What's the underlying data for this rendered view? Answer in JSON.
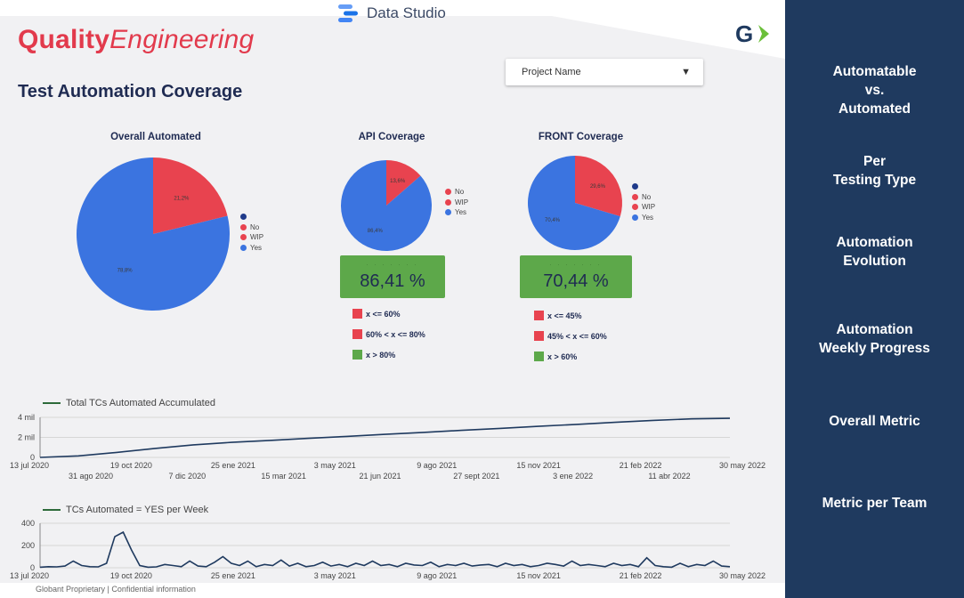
{
  "app": {
    "title": "Data Studio"
  },
  "brand": {
    "bold": "Quality",
    "italic": "Engineering"
  },
  "logo": {
    "letter": "G",
    "accent": "#6bbf3a"
  },
  "page_title": "Test Automation Coverage",
  "project_select": {
    "value": "Project Name"
  },
  "charts": {
    "overall": {
      "title": "Overall Automated",
      "yes_pct_label": "78,8%",
      "no_pct_label": "21,2%"
    },
    "api": {
      "title": "API Coverage",
      "yes_pct_label": "86,4%",
      "no_pct_label": "13,6%",
      "metric": "86,41 %"
    },
    "front": {
      "title": "FRONT Coverage",
      "yes_pct_label": "70,4%",
      "no_pct_label": "29,6%",
      "metric": "70,44 %"
    }
  },
  "legend": {
    "no": "No",
    "wip": "WIP",
    "yes": "Yes"
  },
  "colors": {
    "no": "#e8434f",
    "wip": "#e8434f",
    "yes": "#3b74e0",
    "good": "#5da84a",
    "sidebar": "#1f3a5f",
    "brand": "#e23a4c",
    "line": "#2d6a3a"
  },
  "thresholds_api": [
    "x <= 60%",
    "60% < x <= 80%",
    "x > 80%"
  ],
  "thresholds_front": [
    "x <= 45%",
    "45% < x <= 60%",
    "x > 60%"
  ],
  "chart_data": [
    {
      "type": "pie",
      "title": "Overall Automated",
      "categories": [
        "No",
        "WIP",
        "Yes"
      ],
      "values": [
        21.2,
        0,
        78.8
      ]
    },
    {
      "type": "pie",
      "title": "API Coverage",
      "categories": [
        "No",
        "WIP",
        "Yes"
      ],
      "values": [
        13.6,
        0,
        86.4
      ]
    },
    {
      "type": "pie",
      "title": "FRONT Coverage",
      "categories": [
        "No",
        "WIP",
        "Yes"
      ],
      "values": [
        29.6,
        0,
        70.4
      ]
    },
    {
      "type": "line",
      "legend": "Total TCs Automated Accumulated",
      "y_ticks": [
        "4 mil",
        "2 mil",
        "0"
      ],
      "ylim": [
        0,
        4000
      ],
      "x_ticks_top": [
        "13 jul 2020",
        "19 oct 2020",
        "25 ene 2021",
        "3 may 2021",
        "9 ago 2021",
        "15 nov 2021",
        "21 feb 2022",
        "30 may 2022"
      ],
      "x_ticks_bottom": [
        "31 ago 2020",
        "7 dic 2020",
        "15 mar 2021",
        "21 jun 2021",
        "27 sept 2021",
        "3 ene 2022",
        "11 abr 2022"
      ],
      "series": [
        {
          "name": "Total TCs Automated Accumulated",
          "values": [
            0,
            150,
            500,
            900,
            1250,
            1500,
            1700,
            1900,
            2100,
            2300,
            2500,
            2700,
            2900,
            3100,
            3300,
            3500,
            3700,
            3850,
            3900
          ]
        }
      ]
    },
    {
      "type": "line",
      "legend": "TCs Automated = YES per Week",
      "y_ticks": [
        "400",
        "200",
        "0"
      ],
      "ylim": [
        0,
        400
      ],
      "x_ticks_top": [
        "13 jul 2020",
        "19 oct 2020",
        "25 ene 2021",
        "3 may 2021",
        "9 ago 2021",
        "15 nov 2021",
        "21 feb 2022",
        "30 may 2022"
      ],
      "series": [
        {
          "name": "TCs Automated = YES per Week",
          "values": [
            5,
            10,
            8,
            15,
            60,
            20,
            10,
            8,
            40,
            280,
            320,
            160,
            20,
            5,
            8,
            30,
            20,
            10,
            60,
            15,
            10,
            50,
            100,
            40,
            20,
            60,
            10,
            30,
            20,
            70,
            15,
            40,
            10,
            20,
            50,
            15,
            30,
            10,
            40,
            20,
            60,
            20,
            30,
            10,
            40,
            25,
            20,
            50,
            10,
            30,
            20,
            40,
            15,
            25,
            30,
            10,
            40,
            20,
            30,
            10,
            20,
            40,
            30,
            15,
            60,
            20,
            30,
            20,
            10,
            40,
            20,
            30,
            10,
            90,
            20,
            10,
            5,
            40,
            10,
            30,
            20,
            60,
            15,
            10
          ]
        }
      ]
    }
  ],
  "footer": "Globant Proprietary | Confidential information",
  "sidebar": [
    "Automatable vs. Automated",
    "Per Testing Type",
    "Automation Evolution",
    "Automation Weekly Progress",
    "Overall Metric",
    "Metric per Team"
  ]
}
